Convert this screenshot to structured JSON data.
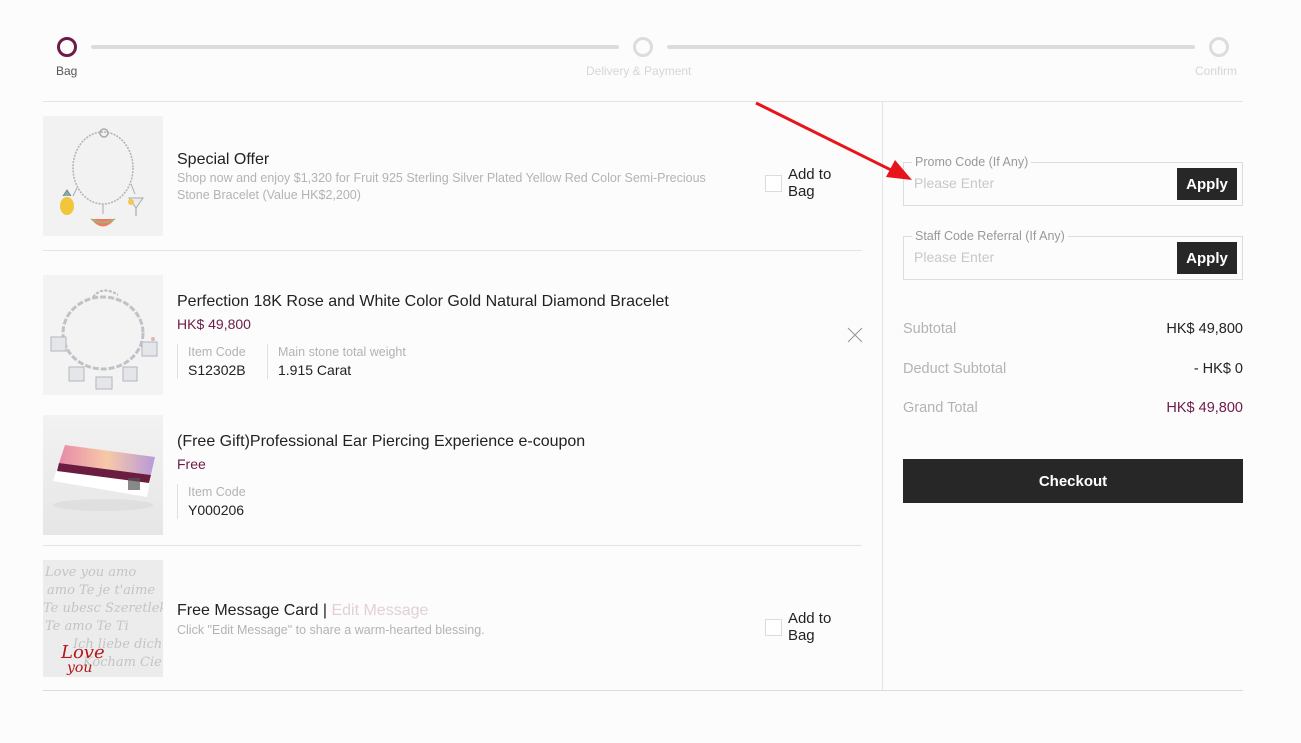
{
  "stepper": {
    "steps": [
      {
        "label": "Bag",
        "active": true
      },
      {
        "label": "Delivery & Payment",
        "active": false
      },
      {
        "label": "Confirm",
        "active": false
      }
    ]
  },
  "items": {
    "special_offer": {
      "title": "Special Offer",
      "description": "Shop now and enjoy $1,320 for Fruit 925 Sterling Silver Plated Yellow Red Color Semi-Precious Stone Bracelet (Value HK$2,200)",
      "add_label": "Add to Bag",
      "image_icon": "fruit-charm-bracelet"
    },
    "bracelet": {
      "title": "Perfection 18K Rose and White Color Gold Natural Diamond Bracelet",
      "price": "HK$ 49,800",
      "specs": [
        {
          "label": "Item Code",
          "value": "S12302B"
        },
        {
          "label": "Main stone total weight",
          "value": "1.915 Carat"
        }
      ],
      "remove_icon": "close-icon",
      "image_icon": "diamond-handbag-charm-bracelet"
    },
    "gift": {
      "title": "(Free Gift)Professional Ear Piercing Experience e-coupon",
      "price": "Free",
      "specs": [
        {
          "label": "Item Code",
          "value": "Y000206"
        }
      ],
      "image_icon": "e-coupon-card"
    },
    "message_card": {
      "title": "Free Message Card",
      "separator": "|",
      "edit_link": "Edit Message",
      "description": "Click \"Edit Message\" to share a warm-hearted blessing.",
      "add_label": "Add to Bag",
      "image_icon": "love-you-message-card"
    }
  },
  "promo": {
    "promo_code": {
      "legend": "Promo Code (If Any)",
      "placeholder": "Please Enter",
      "value": "",
      "button": "Apply"
    },
    "staff_code": {
      "legend": "Staff Code Referral (If Any)",
      "placeholder": "Please Enter",
      "value": "",
      "button": "Apply"
    }
  },
  "summary": {
    "rows": [
      {
        "label": "Subtotal",
        "value": "HK$ 49,800"
      },
      {
        "label": "Deduct Subtotal",
        "value": "- HK$ 0"
      },
      {
        "label": "Grand Total",
        "value": "HK$ 49,800"
      }
    ],
    "checkout_label": "Checkout"
  },
  "colors": {
    "accent": "#6e1b48",
    "button_dark": "#272727",
    "inactive": "#dcdcdc",
    "annotation_arrow": "#e8141b"
  }
}
